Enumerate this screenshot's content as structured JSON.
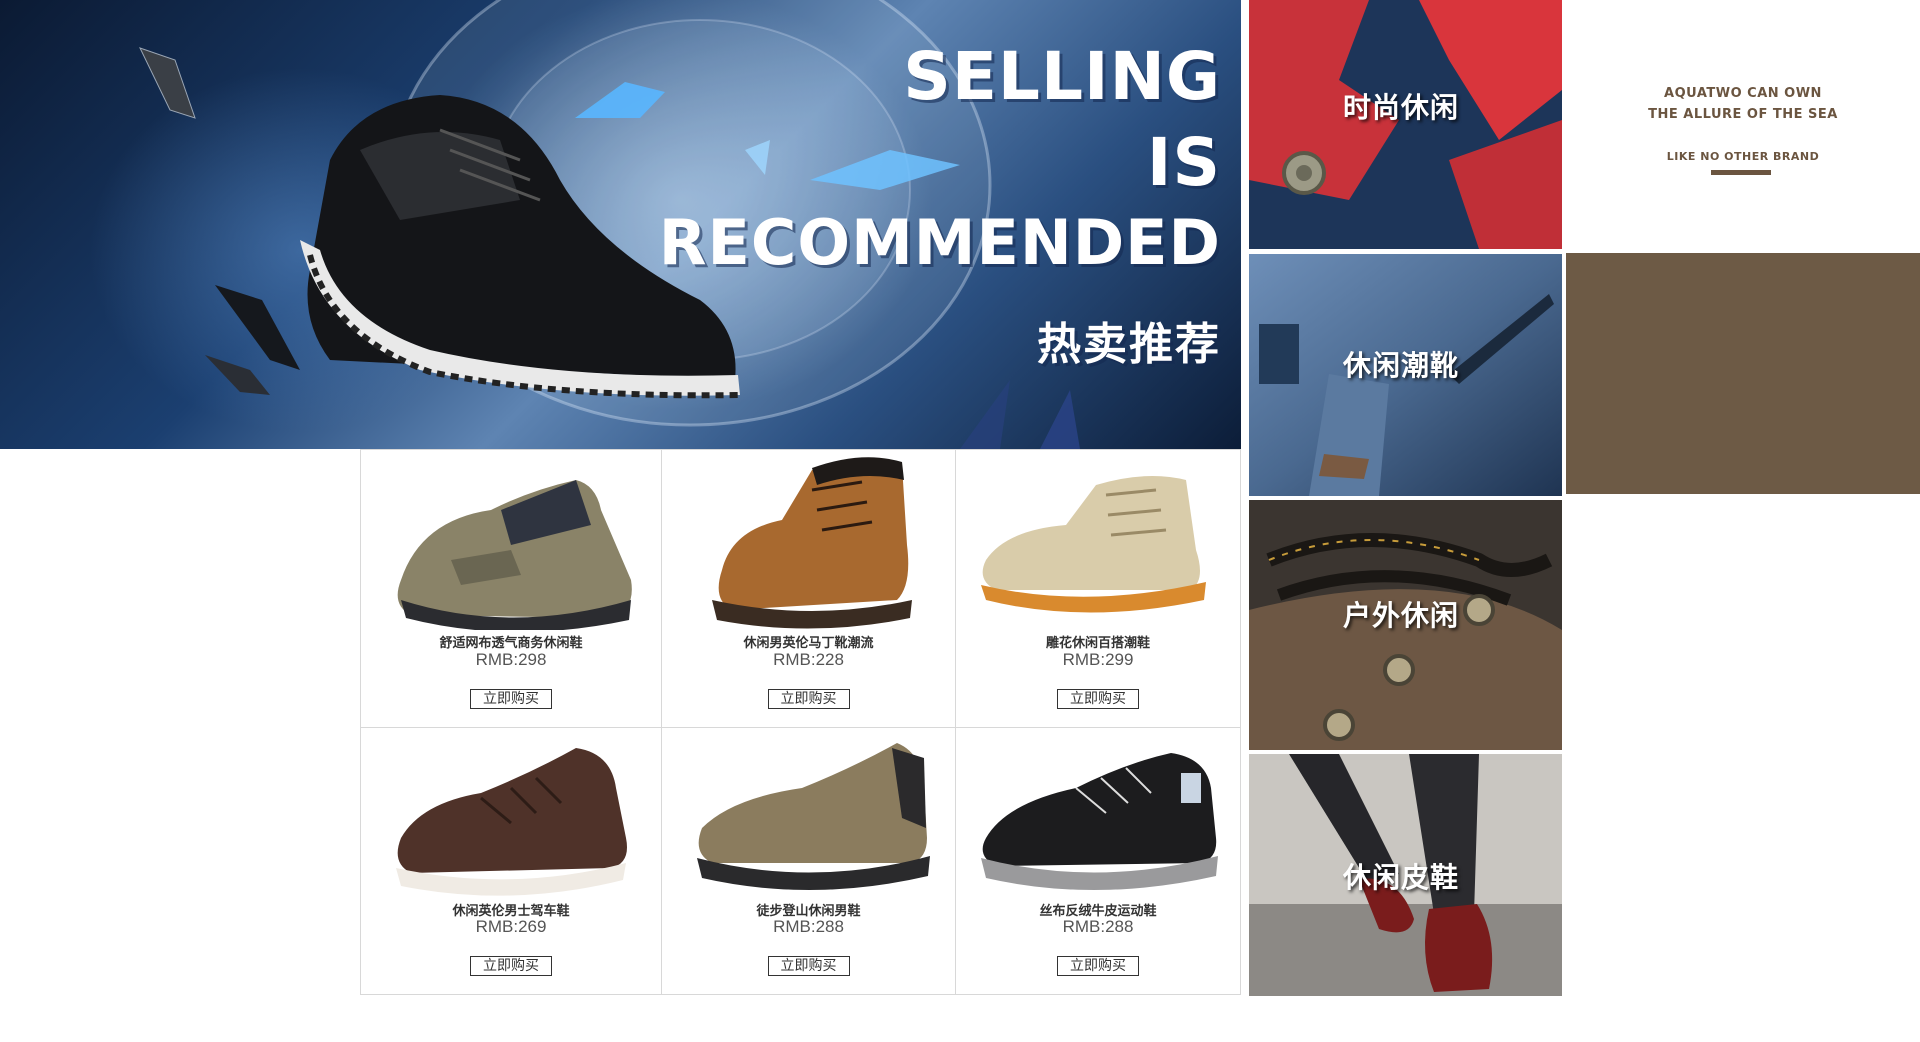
{
  "hero": {
    "title_line1": "SELLING",
    "title_line2": "IS",
    "title_line3": "RECOMMENDED",
    "subtitle": "热卖推荐"
  },
  "products": [
    {
      "name": "舒适网布透气商务休闲鞋",
      "price": "RMB:298",
      "buy_label": "立即购买",
      "color": "#8a8368"
    },
    {
      "name": "休闲男英伦马丁靴潮流",
      "price": "RMB:228",
      "buy_label": "立即购买",
      "color": "#a8692f"
    },
    {
      "name": "雕花休闲百搭潮鞋",
      "price": "RMB:299",
      "buy_label": "立即购买",
      "color": "#d9ccaa"
    },
    {
      "name": "休闲英伦男士驾车鞋",
      "price": "RMB:269",
      "buy_label": "立即购买",
      "color": "#4f3229"
    },
    {
      "name": "徒步登山休闲男鞋",
      "price": "RMB:288",
      "buy_label": "立即购买",
      "color": "#8b7c5e"
    },
    {
      "name": "丝布反绒牛皮运动鞋",
      "price": "RMB:288",
      "buy_label": "立即购买",
      "color": "#1c1c1e"
    }
  ],
  "categories": [
    {
      "label": "时尚休闲"
    },
    {
      "label": "休闲潮靴"
    },
    {
      "label": "户外休闲"
    },
    {
      "label": "休闲皮鞋"
    }
  ],
  "brand": {
    "line1": "AQUATWO CAN OWN",
    "line2": "THE ALLURE OF THE SEA",
    "line3": "LIKE NO OTHER BRAND",
    "accent_color": "#6d5a45"
  }
}
